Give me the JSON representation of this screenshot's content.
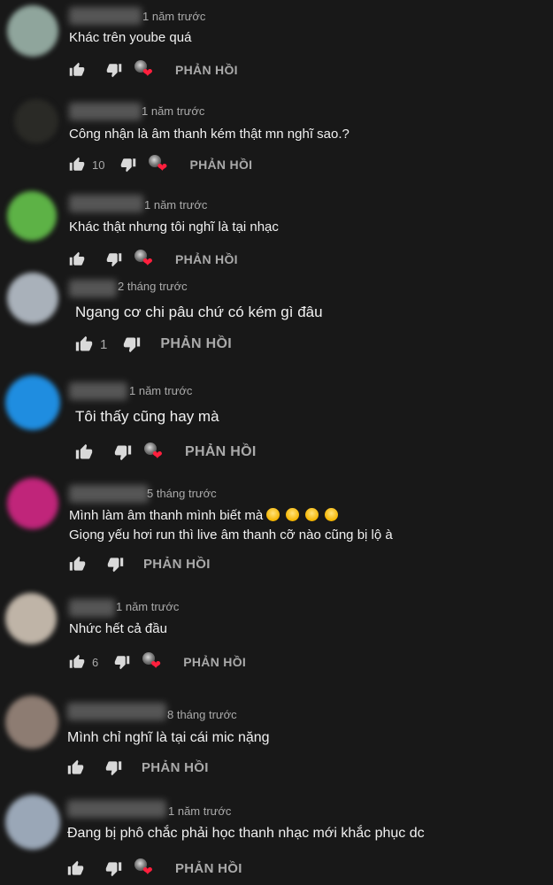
{
  "comments": [
    {
      "time": "1 năm trước",
      "lines": [
        "Khác trên yoube quá"
      ],
      "likes": "",
      "reply": "PHẢN HỒI",
      "hearted": true,
      "avatar_color": "#8fa59c"
    },
    {
      "time": "1 năm trước",
      "lines": [
        "Công nhận là âm thanh kém thật mn nghĩ sao.?"
      ],
      "likes": "10",
      "reply": "PHẢN HỒI",
      "hearted": true,
      "avatar_color": "#2a2a26"
    },
    {
      "time": "1 năm trước",
      "lines": [
        "Khác thật  nhưng tôi nghĩ là tại nhạc"
      ],
      "likes": "",
      "reply": "PHẢN HỒI",
      "hearted": true,
      "avatar_color": "#5db246"
    },
    {
      "time": "2 tháng trước",
      "lines": [
        "Ngang cơ chi pâu chứ có kém gì đâu"
      ],
      "likes": "1",
      "reply": "PHẢN HỒI",
      "hearted": false,
      "avatar_color": "#a9b1ba"
    },
    {
      "time": "1 năm trước",
      "lines": [
        "Tôi thấy cũng hay mà"
      ],
      "likes": "",
      "reply": "PHẢN HỒI",
      "hearted": true,
      "avatar_color": "#1f8de0"
    },
    {
      "time": "5 tháng trước",
      "lines": [
        "Mình làm âm thanh mình biết mà",
        "Giọng yếu hơi run thì live âm thanh cỡ nào cũng bị lộ à"
      ],
      "emoji_count": 4,
      "likes": "",
      "reply": "PHẢN HỒI",
      "hearted": false,
      "avatar_color": "#c0257a"
    },
    {
      "time": "1 năm trước",
      "lines": [
        "Nhức hết cả đầu"
      ],
      "likes": "6",
      "reply": "PHẢN HỒI",
      "hearted": true,
      "avatar_color": "#bfb4a7"
    },
    {
      "time": "8 tháng trước",
      "lines": [
        "Mình chỉ nghĩ là tại cái mic nặng"
      ],
      "likes": "",
      "reply": "PHẢN HỒI",
      "hearted": false,
      "avatar_color": "#8d7c72"
    },
    {
      "time": "1 năm trước",
      "lines": [
        "Đang bị phô chắc phải học thanh nhạc mới khắc phục dc"
      ],
      "likes": "",
      "reply": "PHẢN HỒI",
      "hearted": true,
      "avatar_color": "#9aa7b7"
    }
  ],
  "icons": {
    "like": "thumb-up-icon",
    "dislike": "thumb-down-icon",
    "heart": "creator-heart-icon"
  },
  "colors": {
    "background": "#181818",
    "text": "#f1f1f1",
    "muted": "#aaaaaa",
    "heart": "#ff1f3d"
  }
}
